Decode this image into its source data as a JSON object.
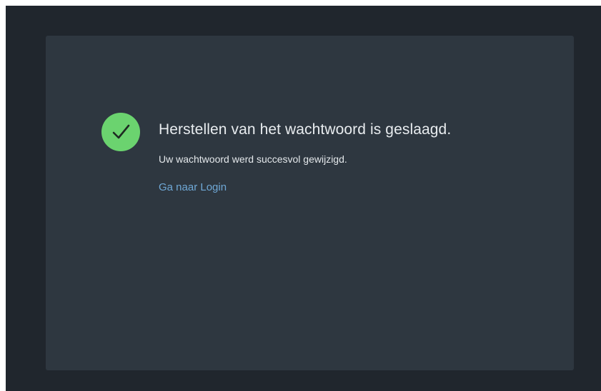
{
  "colors": {
    "background": "#20262d",
    "card": "#2e3740",
    "success": "#6bd36f",
    "link": "#6fa8d6"
  },
  "status": {
    "icon": "checkmark-icon",
    "title": "Herstellen van het wachtwoord is geslaagd.",
    "message": "Uw wachtwoord werd succesvol gewijzigd.",
    "link_label": "Ga naar Login"
  }
}
